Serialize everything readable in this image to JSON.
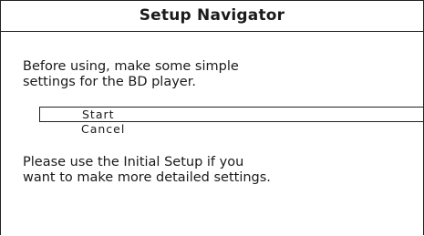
{
  "dialog": {
    "title": "Setup Navigator",
    "intro_text": "Before using, make some simple\nsettings for the BD player.",
    "menu": {
      "items": [
        {
          "label": "Start",
          "selected": true
        },
        {
          "label": "Cancel",
          "selected": false
        }
      ]
    },
    "footer_text": "Please use the Initial Setup if you\nwant to make more detailed settings."
  }
}
